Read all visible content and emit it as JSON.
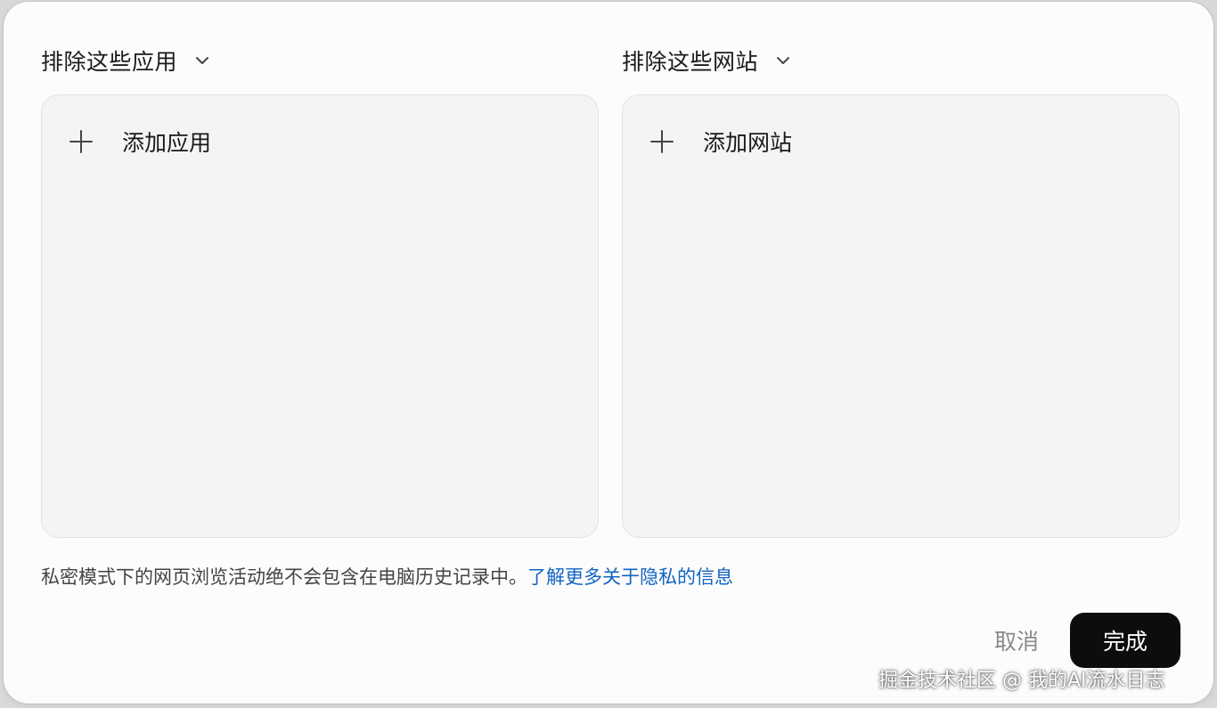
{
  "apps_section": {
    "title": "排除这些应用",
    "add_label": "添加应用",
    "chevron_icon": "chevron-down-icon",
    "plus_icon": "plus-icon"
  },
  "sites_section": {
    "title": "排除这些网站",
    "add_label": "添加网站",
    "chevron_icon": "chevron-down-icon",
    "plus_icon": "plus-icon"
  },
  "footer": {
    "note": "私密模式下的网页浏览活动绝不会包含在电脑历史记录中。",
    "link": "了解更多关于隐私的信息",
    "link_color": "#1264c4"
  },
  "buttons": {
    "cancel": "取消",
    "done": "完成",
    "done_color": "#0d0d0d"
  },
  "watermark": "掘金技术社区 @ 我的AI流水日志"
}
